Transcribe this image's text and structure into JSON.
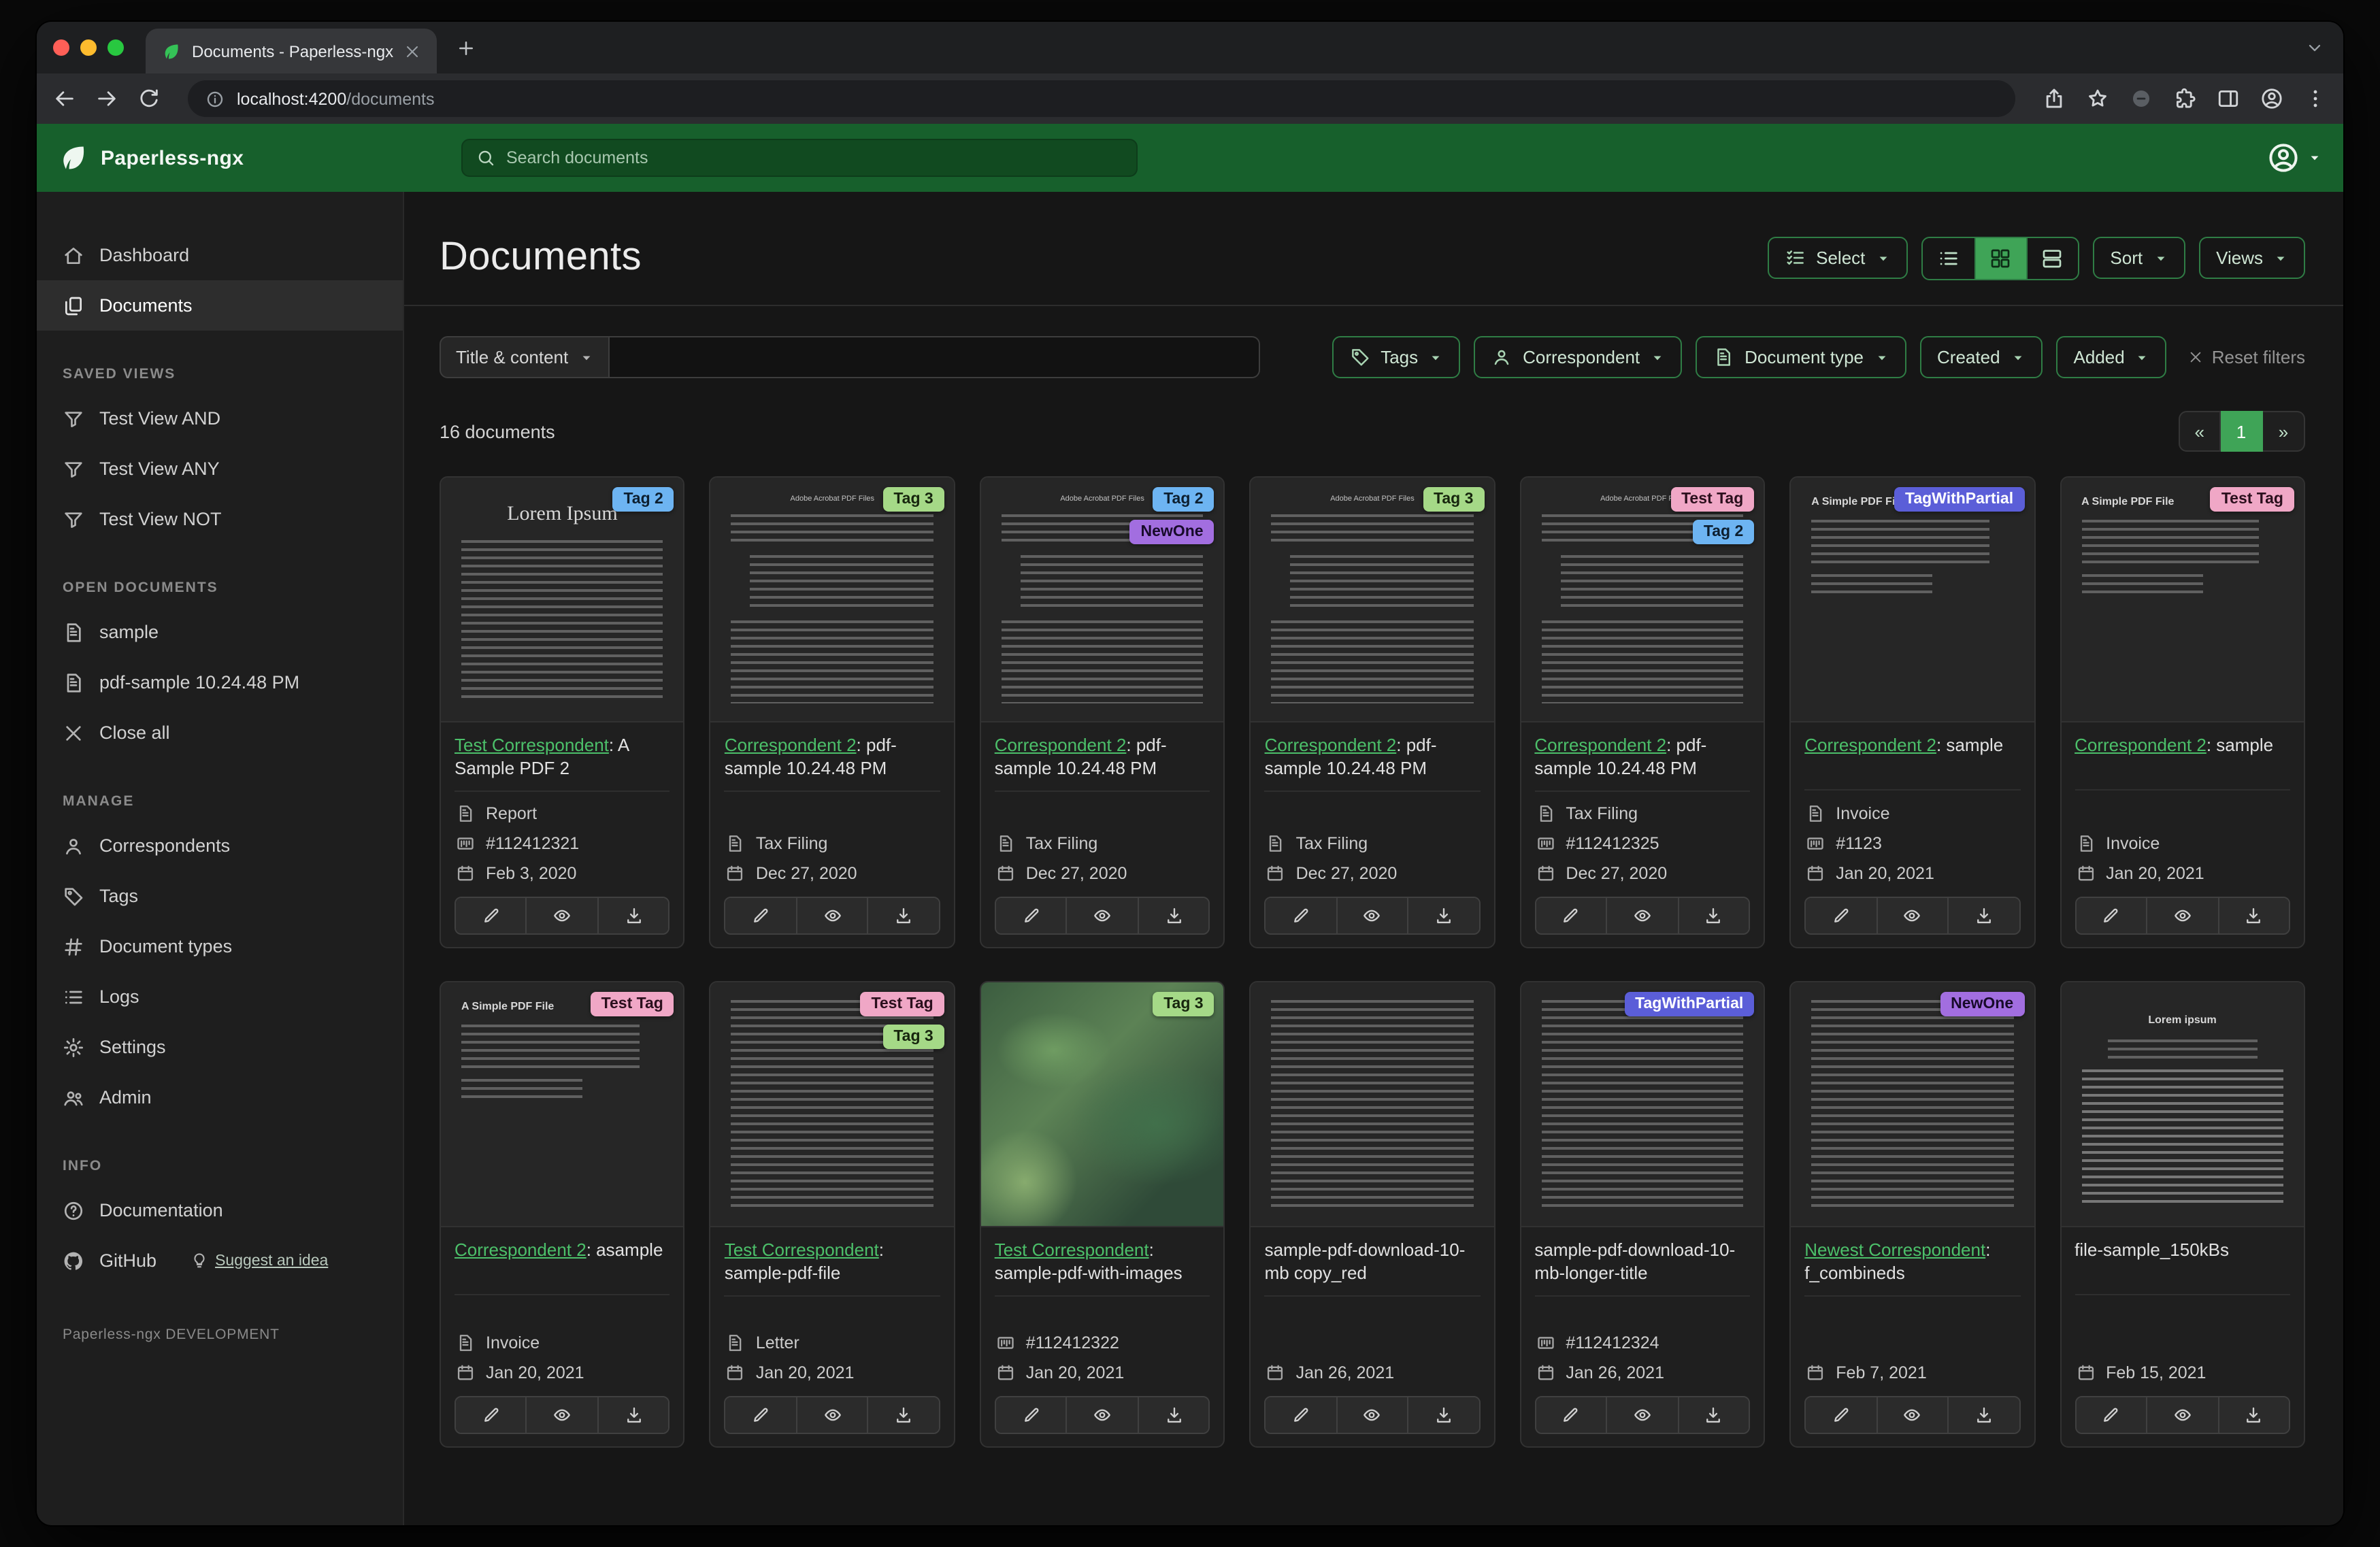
{
  "theme": {
    "header_green": "#17602c",
    "accent_green": "#4cc06a",
    "pagination_active": "#3fa457"
  },
  "browser": {
    "tab_title": "Documents - Paperless-ngx",
    "url_host": "localhost:4200",
    "url_path": "/documents"
  },
  "header": {
    "brand": "Paperless-ngx",
    "search_placeholder": "Search documents"
  },
  "sidebar": {
    "nav": [
      {
        "label": "Dashboard",
        "icon": "house",
        "active": false
      },
      {
        "label": "Documents",
        "icon": "copy",
        "active": true
      }
    ],
    "sections": [
      {
        "heading": "SAVED VIEWS",
        "items": [
          {
            "label": "Test View AND",
            "icon": "funnel"
          },
          {
            "label": "Test View ANY",
            "icon": "funnel"
          },
          {
            "label": "Test View NOT",
            "icon": "funnel"
          }
        ]
      },
      {
        "heading": "OPEN DOCUMENTS",
        "items": [
          {
            "label": "sample",
            "icon": "file-text"
          },
          {
            "label": "pdf-sample 10.24.48 PM",
            "icon": "file-text"
          },
          {
            "label": "Close all",
            "icon": "x"
          }
        ]
      },
      {
        "heading": "MANAGE",
        "items": [
          {
            "label": "Correspondents",
            "icon": "person"
          },
          {
            "label": "Tags",
            "icon": "tag"
          },
          {
            "label": "Document types",
            "icon": "hash"
          },
          {
            "label": "Logs",
            "icon": "list"
          },
          {
            "label": "Settings",
            "icon": "gear"
          },
          {
            "label": "Admin",
            "icon": "people"
          }
        ]
      },
      {
        "heading": "INFO",
        "items": [
          {
            "label": "Documentation",
            "icon": "question"
          },
          {
            "label": "GitHub",
            "icon": "github",
            "extra": "Suggest an idea"
          }
        ]
      }
    ],
    "footer": "Paperless-ngx DEVELOPMENT"
  },
  "main": {
    "title": "Documents",
    "toolbar": {
      "select_label": "Select",
      "sort_label": "Sort",
      "views_label": "Views",
      "active_view": "grid"
    },
    "filters": {
      "field_selector": "Title & content",
      "buttons": [
        {
          "label": "Tags",
          "icon": "tag"
        },
        {
          "label": "Correspondent",
          "icon": "person"
        },
        {
          "label": "Document type",
          "icon": "file-text"
        },
        {
          "label": "Created",
          "icon": null
        },
        {
          "label": "Added",
          "icon": null
        }
      ],
      "reset_label": "Reset filters"
    },
    "count": "16 documents",
    "pagination": {
      "prev": "«",
      "current": "1",
      "next": "»"
    }
  },
  "tag_styles": {
    "Tag 2": {
      "bg": "#6db4f2",
      "fg": "#0d1f30"
    },
    "Tag 3": {
      "bg": "#a5d987",
      "fg": "#17260e"
    },
    "Test Tag": {
      "bg": "#f0a7c6",
      "fg": "#2b0f1d"
    },
    "NewOne": {
      "bg": "#a26ee0",
      "fg": "#180b2b"
    },
    "TagWithPartial": {
      "bg": "#5b5ed8",
      "fg": "#ffffff"
    }
  },
  "cards": [
    {
      "thumb": "serif",
      "thumb_heading": "Lorem Ipsum",
      "tags": [
        "Tag 2"
      ],
      "link": "Test Correspondent",
      "rest": ": A Sample PDF 2",
      "type": "Report",
      "asn": "#112412321",
      "date": "Feb 3, 2020"
    },
    {
      "thumb": "acrobat",
      "thumb_heading": "Adobe Acrobat PDF Files",
      "tags": [
        "Tag 3"
      ],
      "link": "Correspondent 2",
      "rest": ": pdf-sample 10.24.48 PM",
      "type": "Tax Filing",
      "date": "Dec 27, 2020"
    },
    {
      "thumb": "acrobat",
      "thumb_heading": "Adobe Acrobat PDF Files",
      "tags": [
        "Tag 2",
        "NewOne"
      ],
      "link": "Correspondent 2",
      "rest": ": pdf-sample 10.24.48 PM",
      "type": "Tax Filing",
      "date": "Dec 27, 2020"
    },
    {
      "thumb": "acrobat",
      "thumb_heading": "Adobe Acrobat PDF Files",
      "tags": [
        "Tag 3"
      ],
      "link": "Correspondent 2",
      "rest": ": pdf-sample 10.24.48 PM",
      "type": "Tax Filing",
      "date": "Dec 27, 2020"
    },
    {
      "thumb": "acrobat",
      "thumb_heading": "Adobe Acrobat PDF Files",
      "tags": [
        "Test Tag",
        "Tag 2"
      ],
      "link": "Correspondent 2",
      "rest": ": pdf-sample 10.24.48 PM",
      "type": "Tax Filing",
      "asn": "#112412325",
      "date": "Dec 27, 2020"
    },
    {
      "thumb": "simple",
      "thumb_heading": "A Simple PDF File",
      "tags": [
        "TagWithPartial"
      ],
      "link": "Correspondent 2",
      "rest": ": sample",
      "type": "Invoice",
      "asn": "#1123",
      "date": "Jan 20, 2021"
    },
    {
      "thumb": "simple",
      "thumb_heading": "A Simple PDF File",
      "tags": [
        "Test Tag"
      ],
      "link": "Correspondent 2",
      "rest": ": sample",
      "type": "Invoice",
      "date": "Jan 20, 2021"
    },
    {
      "thumb": "simple",
      "thumb_heading": "A Simple PDF File",
      "tags": [
        "Test Tag"
      ],
      "link": "Correspondent 2",
      "rest": ": asample",
      "type": "Invoice",
      "date": "Jan 20, 2021"
    },
    {
      "thumb": "dense",
      "tags": [
        "Test Tag",
        "Tag 3"
      ],
      "link": "Test Correspondent",
      "rest": ": sample-pdf-file",
      "type": "Letter",
      "date": "Jan 20, 2021"
    },
    {
      "thumb": "map",
      "tags": [
        "Tag 3"
      ],
      "link": "Test Correspondent",
      "rest": ": sample-pdf-with-images",
      "asn": "#112412322",
      "date": "Jan 20, 2021"
    },
    {
      "thumb": "dense",
      "tags": [],
      "title": "sample-pdf-download-10-mb copy_red",
      "date": "Jan 26, 2021"
    },
    {
      "thumb": "dense",
      "tags": [
        "TagWithPartial"
      ],
      "title": "sample-pdf-download-10-mb-longer-title",
      "asn": "#112412324",
      "date": "Jan 26, 2021"
    },
    {
      "thumb": "dense",
      "tags": [
        "NewOne"
      ],
      "link": "Newest Correspondent",
      "rest": ": f_combineds",
      "date": "Feb 7, 2021"
    },
    {
      "thumb": "centered",
      "thumb_heading": "Lorem ipsum",
      "tags": [],
      "title": "file-sample_150kBs",
      "date": "Feb 15, 2021"
    }
  ]
}
